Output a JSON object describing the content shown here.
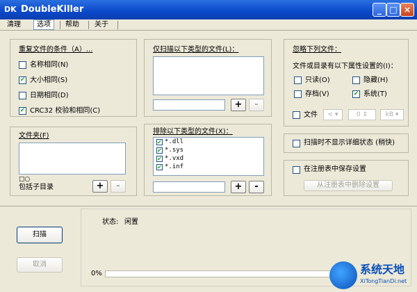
{
  "window": {
    "title": "DoubleKiller",
    "icon_label": "DK"
  },
  "menu": [
    {
      "label": "清理"
    },
    {
      "label": "选项",
      "active": true
    },
    {
      "label": "帮助"
    },
    {
      "label": "关于"
    }
  ],
  "dup_conditions": {
    "title": "重复文件的条件（A）...",
    "items": [
      {
        "label": "名称相同(N)",
        "checked": false
      },
      {
        "label": "大小相同(S)",
        "checked": true
      },
      {
        "label": "日期相同(D)",
        "checked": false
      },
      {
        "label": "CRC32 校验和相同(C)",
        "checked": true
      }
    ]
  },
  "folders": {
    "title": "文件夹(F)",
    "subdir_label": "包括子目录",
    "plus": "+",
    "minus": "-"
  },
  "scan_types": {
    "title": "仅扫描以下类型的文件(L)：",
    "plus": "+",
    "minus": "-"
  },
  "exclude_types": {
    "title": "排除以下类型的文件(X)：",
    "items": [
      "*.dll",
      "*.sys",
      "*.vxd",
      "*.inf"
    ],
    "plus": "+",
    "minus": "-"
  },
  "ignore": {
    "title": "忽略下列文件：",
    "attr_title": "文件或目录有以下属性设置的(I)：",
    "attrs": [
      {
        "label": "只读(O)",
        "checked": false
      },
      {
        "label": "隐藏(H)",
        "checked": false
      },
      {
        "label": "存档(V)",
        "checked": false
      },
      {
        "label": "系统(T)",
        "checked": true
      }
    ],
    "file_label": "文件",
    "op_value": "<",
    "num_value": "0",
    "unit_value": "kB"
  },
  "options": {
    "no_detail_label": "扫描时不显示详细状态 (稍快)",
    "save_registry_label": "在注册表中保存设置",
    "delete_registry_label": "从注册表中删除设置"
  },
  "actions": {
    "scan_label": "扫描",
    "cancel_label": "取消"
  },
  "status": {
    "label": "状态:",
    "value": "闲置",
    "progress_text": "0%",
    "progress": 0
  },
  "watermark": {
    "text": "系统天地",
    "url": "XiTongTianDi.net"
  }
}
